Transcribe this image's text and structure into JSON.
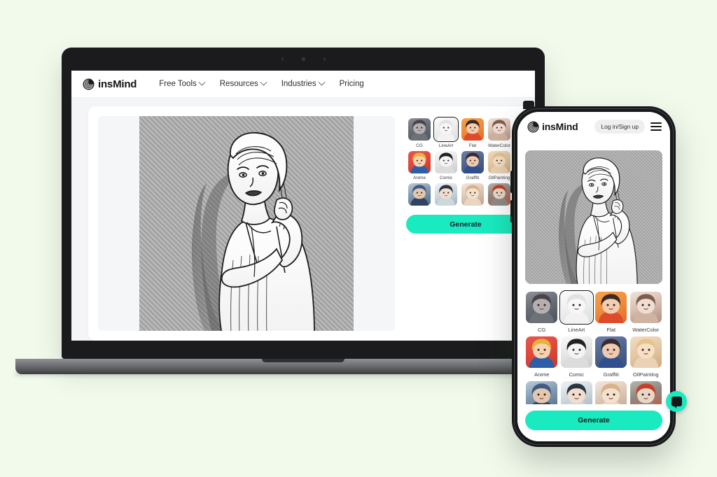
{
  "background_color": "#f2faec",
  "accent_color": "#19eabf",
  "laptop": {
    "header": {
      "logo_icon": "spiral-logo-icon",
      "brand": "insMind",
      "nav": [
        {
          "label": "Free Tools",
          "has_dropdown": true
        },
        {
          "label": "Resources",
          "has_dropdown": true
        },
        {
          "label": "Industries",
          "has_dropdown": true
        },
        {
          "label": "Pricing",
          "has_dropdown": false
        }
      ]
    },
    "app": {
      "preview_alt": "line-art portrait of a woman on hatched grey background",
      "styles": [
        {
          "label": "CG",
          "swatch": "t-cg",
          "selected": false
        },
        {
          "label": "LineArt",
          "swatch": "t-lineart",
          "selected": true
        },
        {
          "label": "Flat",
          "swatch": "t-flat",
          "selected": false
        },
        {
          "label": "WaterColor",
          "swatch": "t-water",
          "selected": false
        },
        {
          "label": "Anime",
          "swatch": "t-anime",
          "selected": false
        },
        {
          "label": "Comic",
          "swatch": "t-comic",
          "selected": false
        },
        {
          "label": "Graffiti",
          "swatch": "t-graffiti",
          "selected": false
        },
        {
          "label": "OilPainting",
          "swatch": "t-oil",
          "selected": false
        },
        {
          "label": "",
          "swatch": "t-r3a",
          "selected": false
        },
        {
          "label": "",
          "swatch": "t-r3b",
          "selected": false
        },
        {
          "label": "",
          "swatch": "t-r3c",
          "selected": false
        },
        {
          "label": "",
          "swatch": "t-r3d",
          "selected": false
        }
      ],
      "generate_label": "Generate"
    }
  },
  "phone": {
    "header": {
      "logo_icon": "spiral-logo-icon",
      "brand": "insMind",
      "login_label": "Log in/Sign up",
      "menu_icon": "hamburger-menu-icon",
      "close_icon": "close-icon"
    },
    "app": {
      "preview_alt": "line-art portrait of a woman on hatched grey background",
      "styles": [
        {
          "label": "CG",
          "swatch": "t-cg",
          "selected": false
        },
        {
          "label": "LineArt",
          "swatch": "t-lineart",
          "selected": true
        },
        {
          "label": "Flat",
          "swatch": "t-flat",
          "selected": false
        },
        {
          "label": "WaterColor",
          "swatch": "t-water",
          "selected": false
        },
        {
          "label": "Anime",
          "swatch": "t-anime",
          "selected": false
        },
        {
          "label": "Comic",
          "swatch": "t-comic",
          "selected": false
        },
        {
          "label": "Graffiti",
          "swatch": "t-graffiti",
          "selected": false
        },
        {
          "label": "OilPainting",
          "swatch": "t-oil",
          "selected": false
        },
        {
          "label": "",
          "swatch": "t-r3a",
          "selected": false
        },
        {
          "label": "",
          "swatch": "t-r3b",
          "selected": false
        },
        {
          "label": "",
          "swatch": "t-r3c",
          "selected": false
        },
        {
          "label": "",
          "swatch": "t-r3d",
          "selected": false
        }
      ],
      "generate_label": "Generate"
    },
    "chat_widget_icon": "chat-bubble-icon"
  }
}
